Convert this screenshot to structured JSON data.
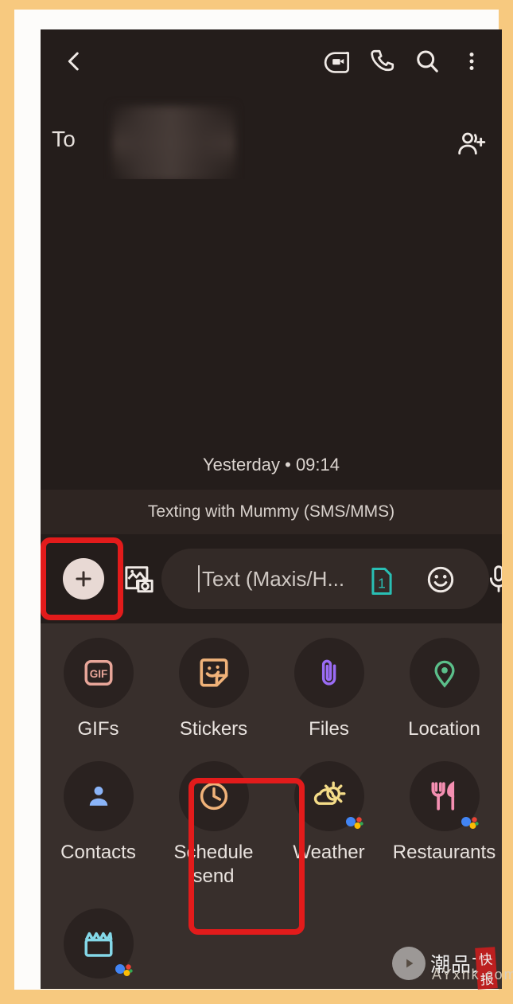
{
  "frame": {
    "outer_border_color": "#F7C97F",
    "inner_border_color": "#FDFCFA",
    "screen_bg": "#241D1B"
  },
  "appbar": {
    "back_icon": "back-arrow-icon",
    "video_call_icon": "video-call-icon",
    "phone_icon": "phone-call-icon",
    "search_icon": "search-icon",
    "overflow_icon": "more-vert-icon"
  },
  "recipient": {
    "to_label": "To",
    "value": "",
    "blurred": true,
    "add_people_icon": "add-people-icon"
  },
  "conversation": {
    "timestamp": "Yesterday • 09:14",
    "sms_banner": "Texting with Mummy (SMS/MMS)"
  },
  "compose": {
    "plus_icon": "plus-icon",
    "gallery_icon": "gallery-camera-icon",
    "placeholder": "Text (Maxis/H...",
    "sim_badge": "1",
    "sim_icon": "sim-card-icon",
    "sim_color": "#29BFB4",
    "emoji_icon": "emoji-smiley-icon",
    "mic_icon": "microphone-icon"
  },
  "tray": {
    "bg": "#382F2C",
    "rows": [
      [
        {
          "label": "GIFs",
          "icon": "gif-icon",
          "color": "#E8A699",
          "badge": false
        },
        {
          "label": "Stickers",
          "icon": "sticker-icon",
          "color": "#F0B279",
          "badge": false
        },
        {
          "label": "Files",
          "icon": "paperclip-icon",
          "color": "#9A6CF5",
          "badge": false
        },
        {
          "label": "Location",
          "icon": "location-pin-icon",
          "color": "#5BBF8A",
          "badge": false
        }
      ],
      [
        {
          "label": "Contacts",
          "icon": "contact-person-icon",
          "color": "#8AB4F8",
          "badge": false
        },
        {
          "label": "Schedule\nsend",
          "icon": "clock-icon",
          "color": "#F0B279",
          "badge": false
        },
        {
          "label": "Weather",
          "icon": "weather-sun-icon",
          "color": "#F4DC88",
          "badge": true
        },
        {
          "label": "Restaurants",
          "icon": "restaurant-icon",
          "color": "#F48FB1",
          "badge": true
        }
      ],
      [
        {
          "label": "",
          "icon": "movie-clapperboard-icon",
          "color": "#84D8E8",
          "badge": true
        }
      ]
    ]
  },
  "annotations": {
    "highlight_color": "#E21B1B",
    "boxes": [
      {
        "name": "plus-button-highlight",
        "target": "plus-icon"
      },
      {
        "name": "schedule-send-highlight",
        "target": "Schedule send"
      }
    ]
  },
  "watermark": {
    "play_icon": "play-icon",
    "cn_text": "潮品文",
    "seal_text": "快报",
    "url": "AYxnk.com"
  }
}
